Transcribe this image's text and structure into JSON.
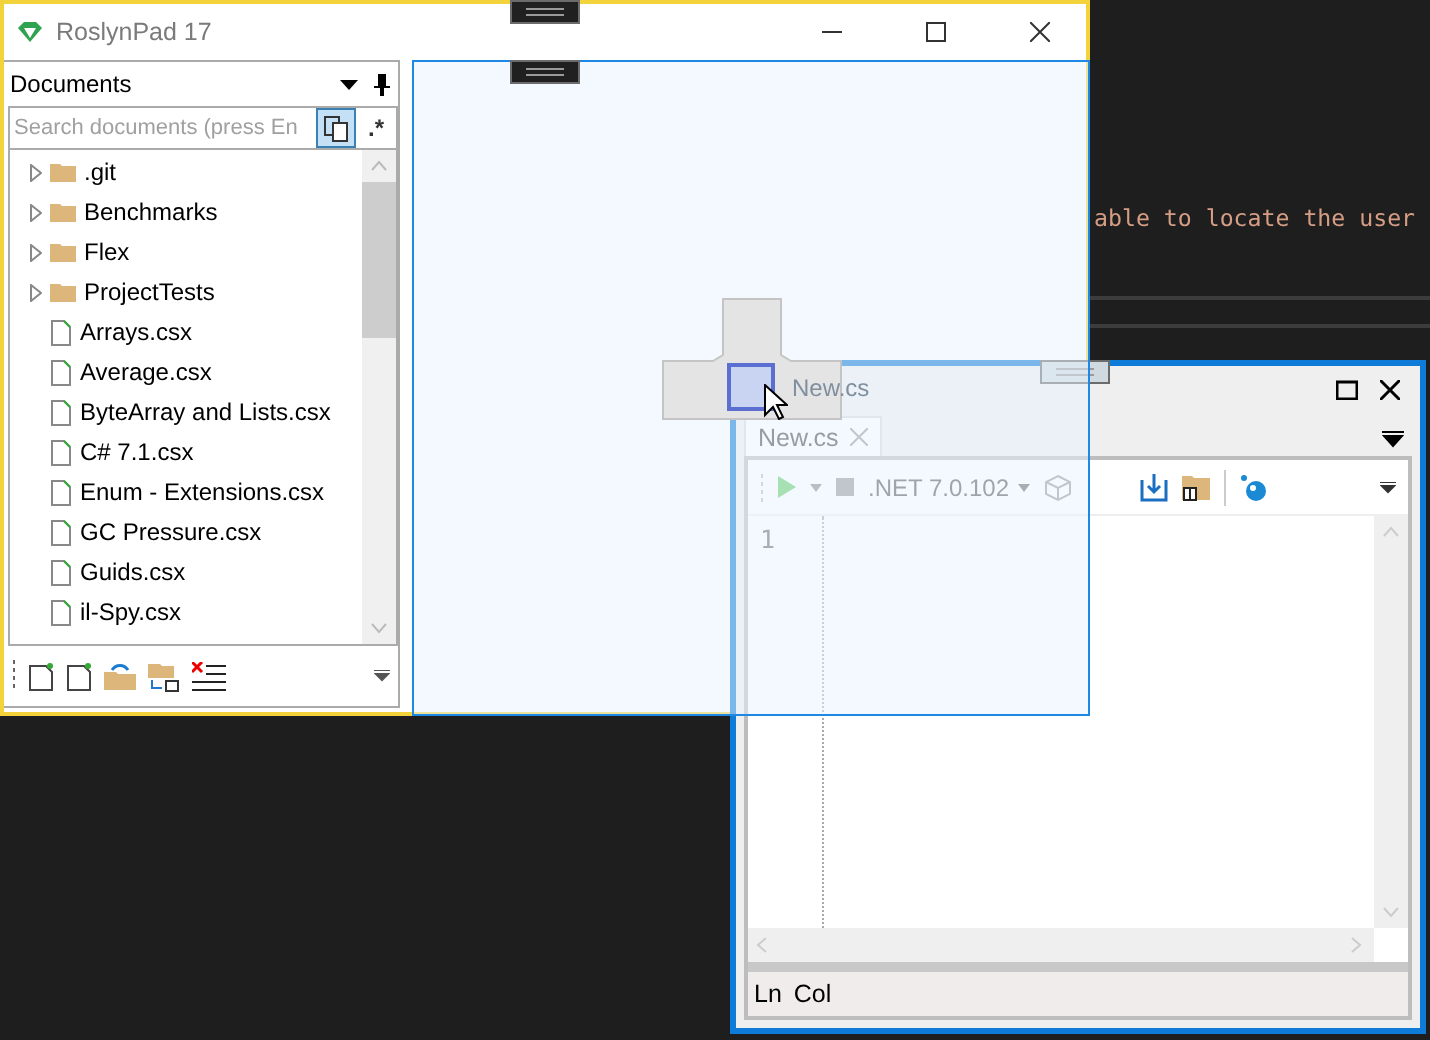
{
  "background_code": {
    "line": "able to locate the user"
  },
  "main_window": {
    "title": "RoslynPad 17"
  },
  "documents_panel": {
    "title": "Documents",
    "search": {
      "placeholder": "Search documents (press En"
    },
    "filter_toggle": {
      "selected": true
    },
    "regex_toggle": {
      "label": ".*",
      "selected": false
    },
    "items": [
      {
        "name": ".git",
        "kind": "folder",
        "expanded": false
      },
      {
        "name": "Benchmarks",
        "kind": "folder",
        "expanded": false
      },
      {
        "name": "Flex",
        "kind": "folder",
        "expanded": false
      },
      {
        "name": "ProjectTests",
        "kind": "folder",
        "expanded": false
      },
      {
        "name": "Arrays.csx",
        "kind": "file"
      },
      {
        "name": "Average.csx",
        "kind": "file"
      },
      {
        "name": "ByteArray and Lists.csx",
        "kind": "file"
      },
      {
        "name": "C# 7.1.csx",
        "kind": "file"
      },
      {
        "name": "Enum - Extensions.csx",
        "kind": "file"
      },
      {
        "name": "GC Pressure.csx",
        "kind": "file"
      },
      {
        "name": "Guids.csx",
        "kind": "file"
      },
      {
        "name": "il-Spy.csx",
        "kind": "file"
      }
    ]
  },
  "dock_preview": {
    "drag_label": "New.cs"
  },
  "editor_window": {
    "tabs": [
      {
        "label": "New.cs",
        "selected": true
      }
    ],
    "runtime": ".NET 7.0.102",
    "line_numbers": [
      "1"
    ],
    "status": {
      "line": "Ln",
      "column": "Col"
    }
  }
}
